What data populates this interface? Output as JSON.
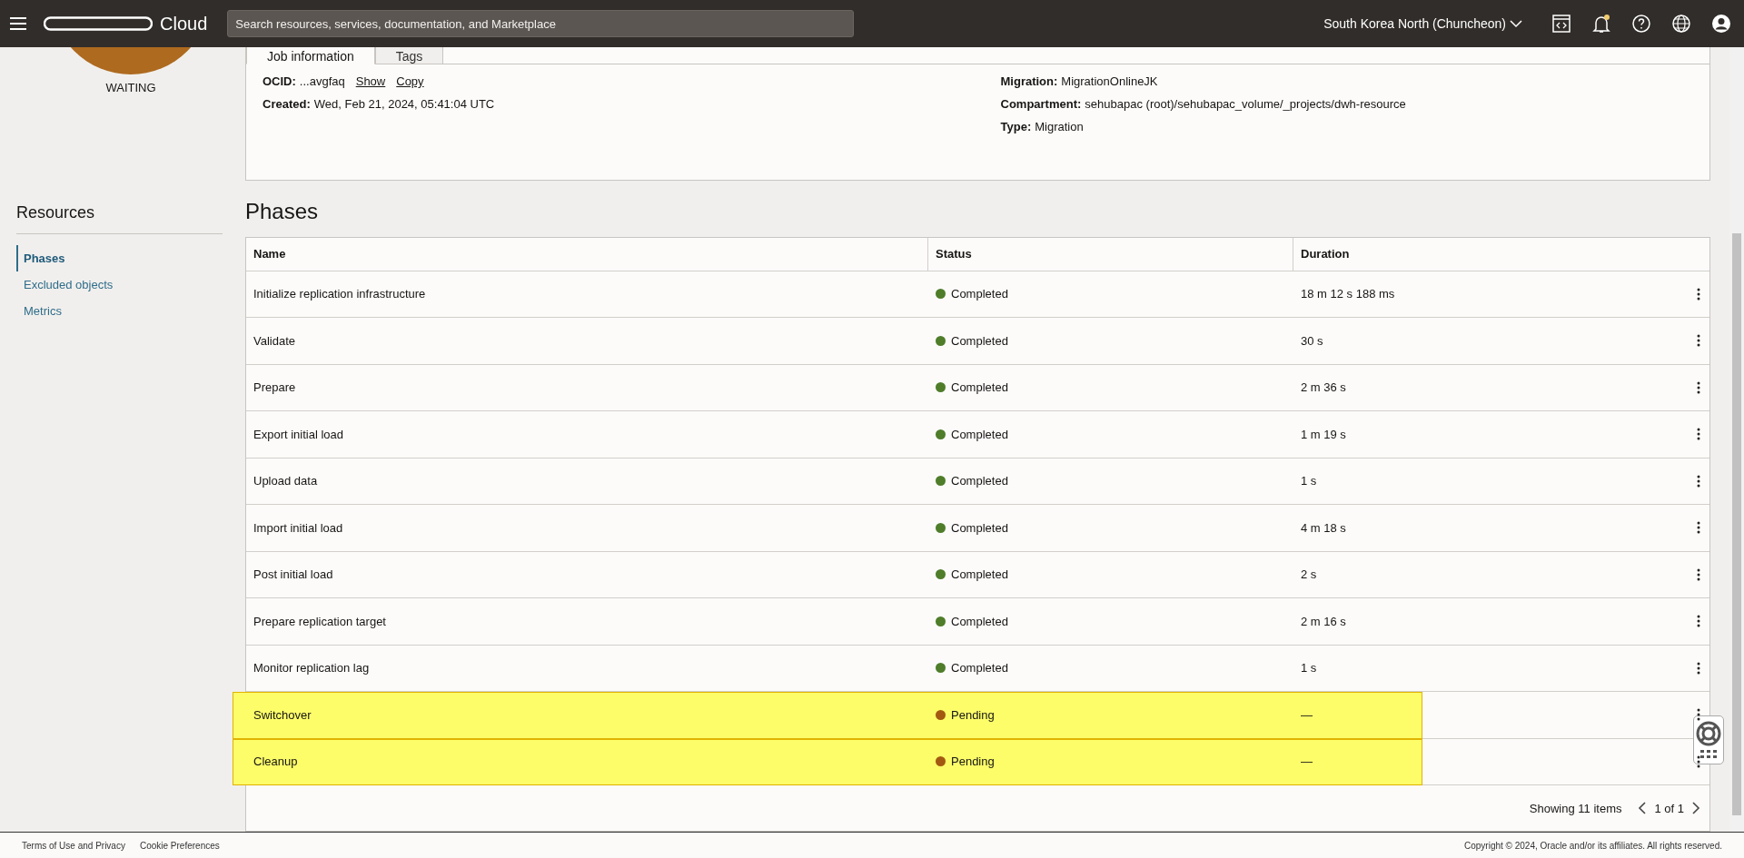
{
  "top_bar": {
    "brand": "Cloud",
    "search": {
      "placeholder": "Search resources, services, documentation, and Marketplace"
    },
    "region": "South Korea North (Chuncheon)",
    "notification_unread": true
  },
  "status_badge": {
    "label": "WAITING"
  },
  "tabs": [
    {
      "label": "Job information",
      "selected": true
    },
    {
      "label": "Tags",
      "selected": false
    }
  ],
  "job_information": {
    "left": [
      {
        "label": "OCID:",
        "value": "...avgfaq",
        "links": [
          "Show",
          "Copy"
        ]
      },
      {
        "label": "Created:",
        "value": "Wed, Feb 21, 2024, 05:41:04 UTC"
      }
    ],
    "right": [
      {
        "label": "Migration:",
        "value": "MigrationOnlineJK"
      },
      {
        "label": "Compartment:",
        "value": "sehubapac (root)/sehubapac_volume/_projects/dwh-resource"
      },
      {
        "label": "Type:",
        "value": "Migration"
      }
    ]
  },
  "resources": {
    "title": "Resources",
    "items": [
      {
        "label": "Phases",
        "selected": true
      },
      {
        "label": "Excluded objects",
        "selected": false
      },
      {
        "label": "Metrics",
        "selected": false
      }
    ]
  },
  "phases": {
    "title": "Phases",
    "columns": [
      "Name",
      "Status",
      "Duration"
    ],
    "rows": [
      {
        "name": "Initialize replication infrastructure",
        "status": "Completed",
        "color": "#4f7d2a",
        "duration": "18 m 12 s 188 ms",
        "highlighted": false
      },
      {
        "name": "Validate",
        "status": "Completed",
        "color": "#4f7d2a",
        "duration": "30 s",
        "highlighted": false
      },
      {
        "name": "Prepare",
        "status": "Completed",
        "color": "#4f7d2a",
        "duration": "2 m 36 s",
        "highlighted": false
      },
      {
        "name": "Export initial load",
        "status": "Completed",
        "color": "#4f7d2a",
        "duration": "1 m 19 s",
        "highlighted": false
      },
      {
        "name": "Upload data",
        "status": "Completed",
        "color": "#4f7d2a",
        "duration": "1 s",
        "highlighted": false
      },
      {
        "name": "Import initial load",
        "status": "Completed",
        "color": "#4f7d2a",
        "duration": "4 m 18 s",
        "highlighted": false
      },
      {
        "name": "Post initial load",
        "status": "Completed",
        "color": "#4f7d2a",
        "duration": "2 s",
        "highlighted": false
      },
      {
        "name": "Prepare replication target",
        "status": "Completed",
        "color": "#4f7d2a",
        "duration": "2 m 16 s",
        "highlighted": false
      },
      {
        "name": "Monitor replication lag",
        "status": "Completed",
        "color": "#4f7d2a",
        "duration": "1 s",
        "highlighted": false
      },
      {
        "name": "Switchover",
        "status": "Pending",
        "color": "#a35a10",
        "duration": "—",
        "highlighted": true
      },
      {
        "name": "Cleanup",
        "status": "Pending",
        "color": "#a35a10",
        "duration": "—",
        "highlighted": true
      }
    ],
    "showing": "Showing 11 items",
    "page": "1 of 1"
  },
  "footer": {
    "links": [
      "Terms of Use and Privacy",
      "Cookie Preferences"
    ],
    "copyright": "Copyright © 2024, Oracle and/or its affiliates. All rights reserved."
  }
}
